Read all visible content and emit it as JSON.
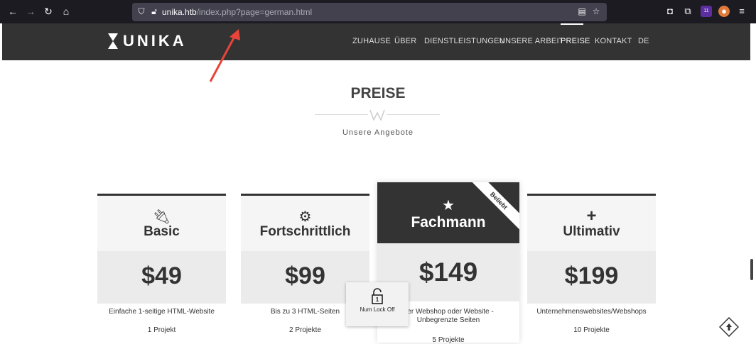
{
  "browser": {
    "url_host": "unika.htb",
    "url_path": "/index.php?page=german.html",
    "extension_badge": "11"
  },
  "site": {
    "logo": "UNIKA",
    "menu": [
      {
        "label": "ZUHAUSE"
      },
      {
        "label": "ÜBER"
      },
      {
        "label": "DIENSTLEISTUNGEN"
      },
      {
        "label": "UNSERE ARBEIT"
      },
      {
        "label": "PREISE",
        "active": true
      },
      {
        "label": "KONTAKT"
      },
      {
        "label": "DE"
      }
    ]
  },
  "pricing": {
    "title": "PREISE",
    "subtitle": "Unsere Angebote",
    "plans": [
      {
        "name": "Basic",
        "icon": "plug-icon",
        "price": "$49",
        "features": [
          "Einfache 1-seitige HTML-Website",
          "1 Projekt"
        ]
      },
      {
        "name": "Fortschrittlich",
        "icon": "gear-icon",
        "price": "$99",
        "features": [
          "Bis zu 3 HTML-Seiten",
          "2 Projekte"
        ]
      },
      {
        "name": "Fachmann",
        "icon": "star-icon",
        "price": "$149",
        "badge": "Beliebt",
        "features": [
          "ßer Webshop oder Website -",
          "Unbegrenzte Seiten",
          "5 Projekte"
        ]
      },
      {
        "name": "Ultimativ",
        "icon": "plus-icon",
        "price": "$199",
        "features": [
          "Unternehmenswebsites/Webshops",
          "10 Projekte"
        ]
      }
    ]
  },
  "overlay": {
    "numlock_label": "Num Lock Off",
    "numlock_digit": "1"
  },
  "colors": {
    "header": "#333333",
    "annotation_arrow": "#e8443a"
  }
}
